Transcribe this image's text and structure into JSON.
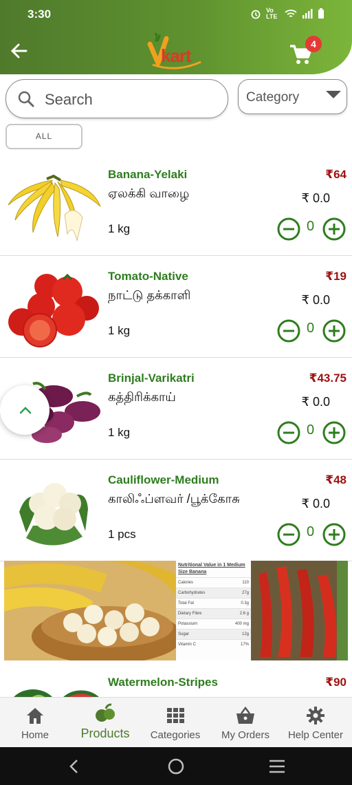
{
  "status_bar": {
    "time": "3:30",
    "network": "Vo LTE"
  },
  "header": {
    "logo_text": "kart",
    "cart_count": "4"
  },
  "search": {
    "placeholder": "Search"
  },
  "category": {
    "label": "Category"
  },
  "filter": {
    "all_label": "ALL"
  },
  "products": [
    {
      "name": "Banana-Yelaki",
      "tamil": "ஏலக்கி வாழை",
      "unit": "1 kg",
      "price": "₹64",
      "total": "₹ 0.0",
      "qty": "0"
    },
    {
      "name": "Tomato-Native",
      "tamil": "நாட்டு தக்காளி",
      "unit": "1 kg",
      "price": "₹19",
      "total": "₹ 0.0",
      "qty": "0"
    },
    {
      "name": "Brinjal-Varikatri",
      "tamil": "கத்திரிக்காய்",
      "unit": "1 kg",
      "price": "₹43.75",
      "total": "₹ 0.0",
      "qty": "0"
    },
    {
      "name": "Cauliflower-Medium",
      "tamil": "காலிஃப்ளவர் /பூக்கோசு",
      "unit": "1 pcs",
      "price": "₹48",
      "total": "₹ 0.0",
      "qty": "0"
    }
  ],
  "banner": {
    "nutrition_title": "Nutritional Value in 1 Medium Size Banana",
    "rows": [
      {
        "k": "Calories",
        "v": "110"
      },
      {
        "k": "Carbohydrates",
        "v": "27g"
      },
      {
        "k": "Total Fat",
        "v": "0.3g"
      },
      {
        "k": "Dietary Fibre",
        "v": "2.6 g"
      },
      {
        "k": "Potassium",
        "v": "400 mg"
      },
      {
        "k": "Sugar",
        "v": "12g"
      },
      {
        "k": "Vitamin C",
        "v": "17%"
      }
    ]
  },
  "partial_product": {
    "name": "Watermelon-Stripes",
    "price": "₹90"
  },
  "bottom_nav": [
    {
      "label": "Home",
      "icon": "home-icon"
    },
    {
      "label": "Products",
      "icon": "fruits-icon"
    },
    {
      "label": "Categories",
      "icon": "grid-icon"
    },
    {
      "label": "My Orders",
      "icon": "basket-icon"
    },
    {
      "label": "Help Center",
      "icon": "gear-icon"
    }
  ],
  "colors": {
    "brand_green": "#4f7a2c",
    "price_red": "#9d1010",
    "name_green": "#2e7d1e",
    "badge_red": "#e53935"
  }
}
